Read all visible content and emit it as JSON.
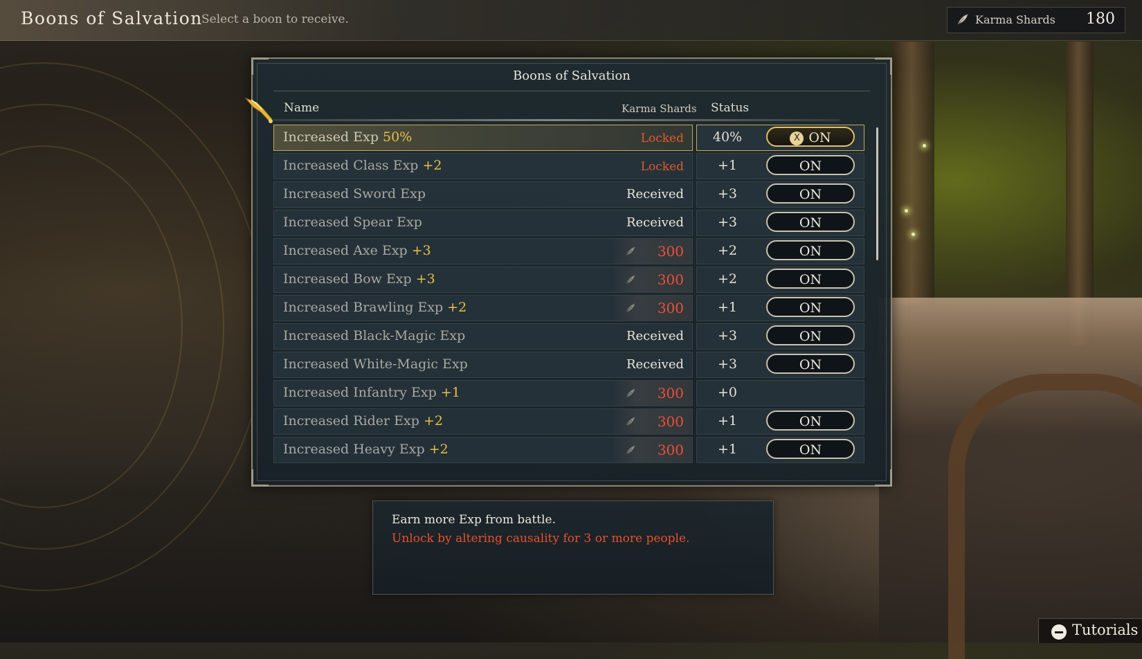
{
  "header": {
    "title": "Boons of Salvation",
    "subtitle": "Select a boon to receive.",
    "currency_label": "Karma Shards",
    "currency_value": "180",
    "currency_icon": "feather-icon"
  },
  "panel": {
    "title": "Boons of Salvation",
    "columns": {
      "name": "Name",
      "cost": "Karma Shards",
      "status": "Status"
    }
  },
  "boons": [
    {
      "name": "Increased Exp",
      "bonus": "50%",
      "cost": "Locked",
      "cost_type": "locked",
      "status": "40%",
      "toggle": "ON",
      "selected": true
    },
    {
      "name": "Increased Class Exp",
      "bonus": "+2",
      "cost": "Locked",
      "cost_type": "locked",
      "status": "+1",
      "toggle": "ON",
      "selected": false
    },
    {
      "name": "Increased Sword Exp",
      "bonus": "",
      "cost": "Received",
      "cost_type": "received",
      "status": "+3",
      "toggle": "ON",
      "selected": false
    },
    {
      "name": "Increased Spear Exp",
      "bonus": "",
      "cost": "Received",
      "cost_type": "received",
      "status": "+3",
      "toggle": "ON",
      "selected": false
    },
    {
      "name": "Increased Axe Exp",
      "bonus": "+3",
      "cost": "300",
      "cost_type": "price",
      "status": "+2",
      "toggle": "ON",
      "selected": false
    },
    {
      "name": "Increased Bow Exp",
      "bonus": "+3",
      "cost": "300",
      "cost_type": "price",
      "status": "+2",
      "toggle": "ON",
      "selected": false
    },
    {
      "name": "Increased Brawling Exp",
      "bonus": "+2",
      "cost": "300",
      "cost_type": "price",
      "status": "+1",
      "toggle": "ON",
      "selected": false
    },
    {
      "name": "Increased Black-Magic Exp",
      "bonus": "",
      "cost": "Received",
      "cost_type": "received",
      "status": "+3",
      "toggle": "ON",
      "selected": false
    },
    {
      "name": "Increased White-Magic Exp",
      "bonus": "",
      "cost": "Received",
      "cost_type": "received",
      "status": "+3",
      "toggle": "ON",
      "selected": false
    },
    {
      "name": "Increased Infantry Exp",
      "bonus": "+1",
      "cost": "300",
      "cost_type": "price",
      "status": "+0",
      "toggle": "",
      "selected": false
    },
    {
      "name": "Increased Rider Exp",
      "bonus": "+2",
      "cost": "300",
      "cost_type": "price",
      "status": "+1",
      "toggle": "ON",
      "selected": false
    },
    {
      "name": "Increased Heavy Exp",
      "bonus": "+2",
      "cost": "300",
      "cost_type": "price",
      "status": "+1",
      "toggle": "ON",
      "selected": false
    }
  ],
  "description": {
    "text": "Earn more Exp from battle.",
    "requirement": "Unlock by altering causality for 3 or more people."
  },
  "footer": {
    "tutorials_label": "Tutorials",
    "tutorials_icon": "minus-button-icon"
  },
  "colors": {
    "accent": "#e8c048",
    "locked": "#e05a2e",
    "price": "#ee4f3a"
  }
}
